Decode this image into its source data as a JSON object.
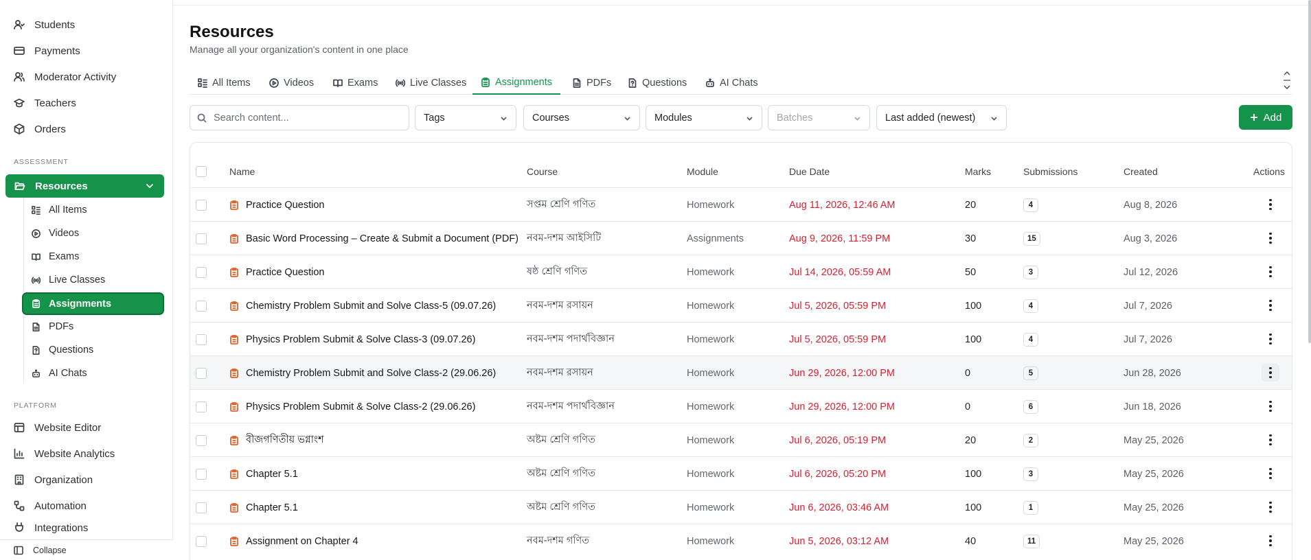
{
  "sidebar": {
    "top_items": [
      {
        "label": "Students",
        "icon": "students-icon"
      },
      {
        "label": "Payments",
        "icon": "payments-icon"
      },
      {
        "label": "Moderator Activity",
        "icon": "moderator-icon"
      },
      {
        "label": "Teachers",
        "icon": "teachers-icon"
      },
      {
        "label": "Orders",
        "icon": "orders-icon"
      }
    ],
    "section_assessment": "ASSESSMENT",
    "resources_label": "Resources",
    "sub_items": [
      {
        "label": "All Items"
      },
      {
        "label": "Videos"
      },
      {
        "label": "Exams"
      },
      {
        "label": "Live Classes"
      },
      {
        "label": "Assignments",
        "active": true
      },
      {
        "label": "PDFs"
      },
      {
        "label": "Questions"
      },
      {
        "label": "AI Chats"
      }
    ],
    "section_platform": "PLATFORM",
    "platform_items": [
      {
        "label": "Website Editor"
      },
      {
        "label": "Website Analytics"
      },
      {
        "label": "Organization"
      },
      {
        "label": "Automation"
      },
      {
        "label": "Integrations"
      }
    ],
    "collapse_label": "Collapse"
  },
  "header": {
    "title": "Resources",
    "subtitle": "Manage all your organization's content in one place"
  },
  "tabs": [
    {
      "label": "All Items"
    },
    {
      "label": "Videos"
    },
    {
      "label": "Exams"
    },
    {
      "label": "Live Classes"
    },
    {
      "label": "Assignments",
      "active": true
    },
    {
      "label": "PDFs"
    },
    {
      "label": "Questions"
    },
    {
      "label": "AI Chats"
    }
  ],
  "filters": {
    "search_placeholder": "Search content...",
    "tags": "Tags",
    "courses": "Courses",
    "modules": "Modules",
    "batches": "Batches",
    "sort": "Last added (newest)",
    "add_label": "Add"
  },
  "table": {
    "columns": [
      "Name",
      "Course",
      "Module",
      "Due Date",
      "Marks",
      "Submissions",
      "Created",
      "Actions"
    ],
    "rows": [
      {
        "name": "Practice Question",
        "course": "সপ্তম শ্রেণি গণিত",
        "module": "Homework",
        "due": "Aug 11, 2026, 12:46 AM",
        "marks": "20",
        "submissions": "4",
        "created": "Aug 8, 2026"
      },
      {
        "name": "Basic Word Processing – Create & Submit a Document (PDF)",
        "course": "নবম-দশম আইসিটি",
        "module": "Assignments",
        "due": "Aug 9, 2026, 11:59 PM",
        "marks": "30",
        "submissions": "15",
        "created": "Aug 3, 2026"
      },
      {
        "name": "Practice Question",
        "course": "ষষ্ঠ শ্রেণি গণিত",
        "module": "Homework",
        "due": "Jul 14, 2026, 05:59 AM",
        "marks": "50",
        "submissions": "3",
        "created": "Jul 12, 2026"
      },
      {
        "name": "Chemistry Problem Submit and Solve Class-5 (09.07.26)",
        "course": "নবম-দশম রসায়ন",
        "module": "Homework",
        "due": "Jul 5, 2026, 05:59 PM",
        "marks": "100",
        "submissions": "4",
        "created": "Jul 7, 2026"
      },
      {
        "name": "Physics Problem Submit & Solve Class-3 (09.07.26)",
        "course": "নবম-দশম পদার্থবিজ্ঞান",
        "module": "Homework",
        "due": "Jul 5, 2026, 05:59 PM",
        "marks": "100",
        "submissions": "4",
        "created": "Jul 7, 2026"
      },
      {
        "name": "Chemistry Problem Submit and Solve Class-2 (29.06.26)",
        "course": "নবম-দশম রসায়ন",
        "module": "Homework",
        "due": "Jun 29, 2026, 12:00 PM",
        "marks": "0",
        "submissions": "5",
        "created": "Jun 28, 2026",
        "hover": true
      },
      {
        "name": "Physics Problem Submit & Solve Class-2 (29.06.26)",
        "course": "নবম-দশম পদার্থবিজ্ঞান",
        "module": "Homework",
        "due": "Jun 29, 2026, 12:00 PM",
        "marks": "0",
        "submissions": "6",
        "created": "Jun 18, 2026"
      },
      {
        "name": "বীজগণিতীয় ভগ্নাংশ",
        "course": "অষ্টম শ্রেণি গণিত",
        "module": "Homework",
        "due": "Jul 6, 2026, 05:19 PM",
        "marks": "20",
        "submissions": "2",
        "created": "May 25, 2026"
      },
      {
        "name": "Chapter 5.1",
        "course": "অষ্টম শ্রেণি গণিত",
        "module": "Homework",
        "due": "Jul 6, 2026, 05:20 PM",
        "marks": "100",
        "submissions": "3",
        "created": "May 25, 2026"
      },
      {
        "name": "Chapter 5.1",
        "course": "অষ্টম শ্রেণি গণিত",
        "module": "Homework",
        "due": "Jun 6, 2026, 03:46 AM",
        "marks": "100",
        "submissions": "1",
        "created": "May 25, 2026"
      },
      {
        "name": "Assignment on Chapter 4",
        "course": "নবম-দশম গণিত",
        "module": "Homework",
        "due": "Jun 5, 2026, 03:12 AM",
        "marks": "40",
        "submissions": "11",
        "created": "May 25, 2026"
      }
    ]
  },
  "colors": {
    "accent": "#16934a",
    "due": "#dc1e2d",
    "assignment_icon": "#e0622a"
  }
}
